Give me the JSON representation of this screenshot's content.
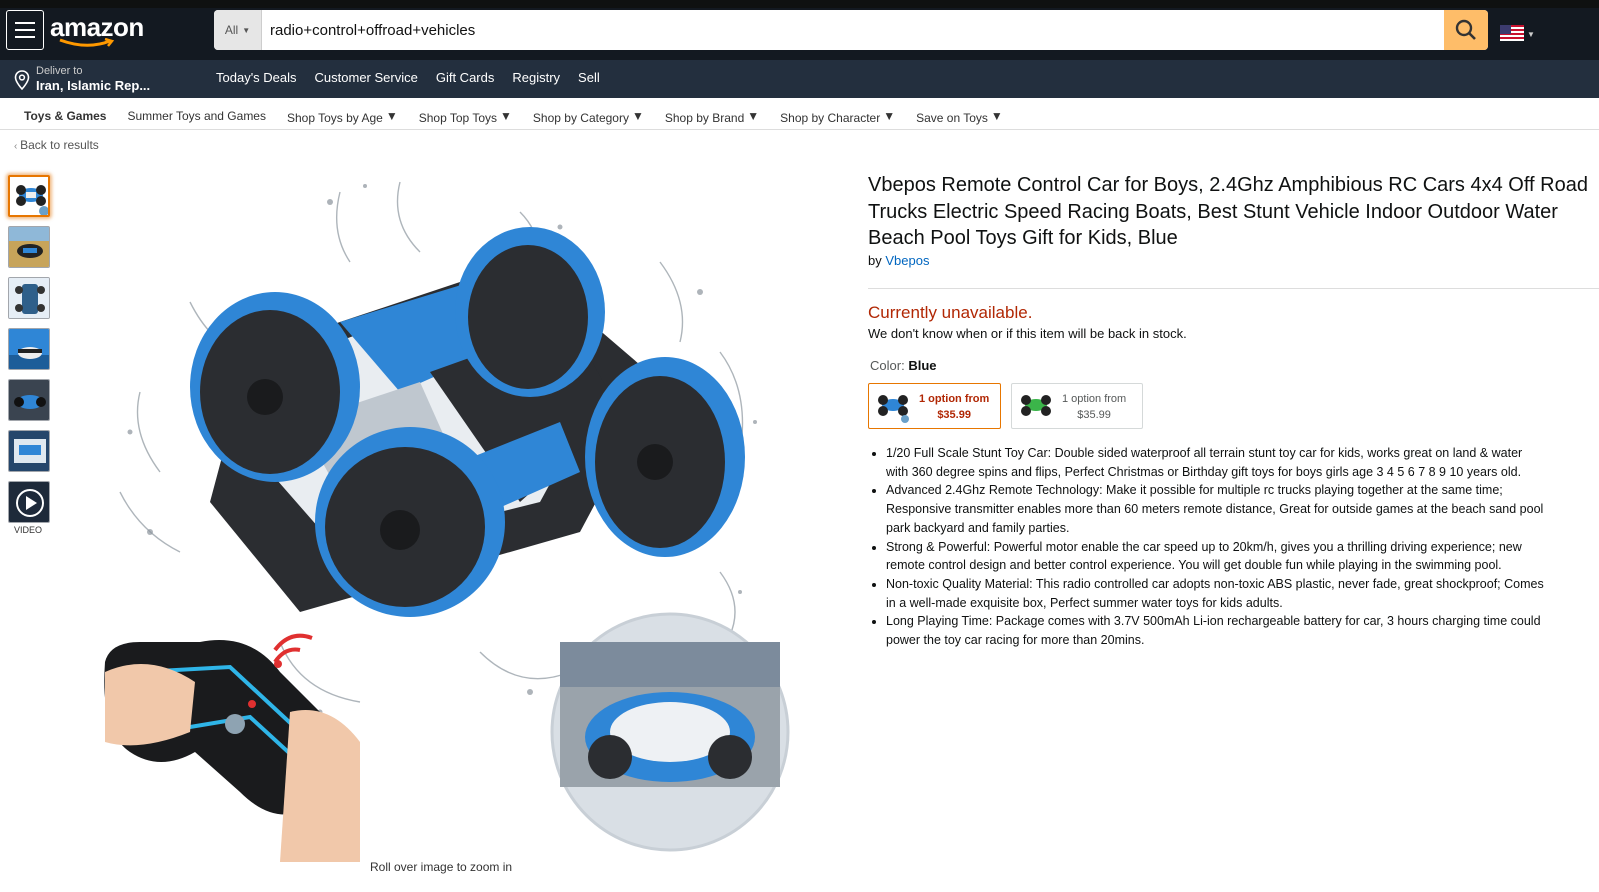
{
  "header": {
    "logo": "amazon",
    "search": {
      "category": "All",
      "value": "radio+control+offroad+vehicles"
    },
    "deliver": {
      "line1": "Deliver to",
      "line2": "Iran, Islamic Rep..."
    },
    "nav": [
      "Today's Deals",
      "Customer Service",
      "Gift Cards",
      "Registry",
      "Sell"
    ]
  },
  "category_nav": {
    "items": [
      {
        "label": "Toys & Games",
        "bold": true,
        "dropdown": false
      },
      {
        "label": "Summer Toys and Games",
        "dropdown": false
      },
      {
        "label": "Shop Toys by Age",
        "dropdown": true
      },
      {
        "label": "Shop Top Toys",
        "dropdown": true
      },
      {
        "label": "Shop by Category",
        "dropdown": true
      },
      {
        "label": "Shop by Brand",
        "dropdown": true
      },
      {
        "label": "Shop by Character",
        "dropdown": true
      },
      {
        "label": "Save on Toys",
        "dropdown": true
      }
    ]
  },
  "back_link": "Back to results",
  "gallery": {
    "video_label": "VIDEO",
    "zoom_hint": "Roll over image to zoom in"
  },
  "product": {
    "title": "Vbepos Remote Control Car for Boys, 2.4Ghz Amphibious RC Cars 4x4 Off Road Trucks Electric Speed Racing Boats, Best Stunt Vehicle Indoor Outdoor Water Beach Pool Toys Gift for Kids, Blue",
    "by_prefix": "by",
    "brand": "Vbepos",
    "availability": "Currently unavailable.",
    "availability_note": "We don't know when or if this item will be back in stock.",
    "color_label": "Color:",
    "color_value": "Blue",
    "swatches": [
      {
        "line1": "1 option from",
        "line2": "$35.99",
        "selected": true
      },
      {
        "line1": "1 option from",
        "line2": "$35.99",
        "selected": false
      }
    ],
    "bullets": [
      "1/20 Full Scale Stunt Toy Car: Double sided waterproof all terrain stunt toy car for kids, works great on land & water\nwith 360 degree spins and flips, Perfect Christmas or Birthday gift toys for boys girls age 3 4 5 6 7 8 9 10 years old.",
      "Advanced 2.4Ghz Remote Technology: Make it possible for multiple rc trucks playing together at the same time;\nResponsive transmitter enables more than 60 meters remote distance, Great for outside games at the beach sand pool\npark backyard and family parties.",
      "Strong & Powerful: Powerful motor enable the car speed up to 20km/h, gives you a thrilling driving experience; new\nremote control design and better control experience. You will get double fun while playing in the swimming pool.",
      "Non-toxic Quality Material: This radio controlled car adopts non-toxic ABS plastic, never fade, great shockproof; Comes\nin a well-made exquisite box, Perfect summer water toys for kids adults.",
      "Long Playing Time: Package comes with 3.7V 500mAh Li-ion rechargeable battery for car, 3 hours charging time could\npower the toy car racing for more than 20mins."
    ]
  },
  "colors": {
    "header_bg": "#131921",
    "subnav_bg": "#232f3e",
    "search_button": "#febd69",
    "unavailable": "#b12704",
    "link": "#0066c0",
    "accent_blue": "#2f86d6"
  }
}
